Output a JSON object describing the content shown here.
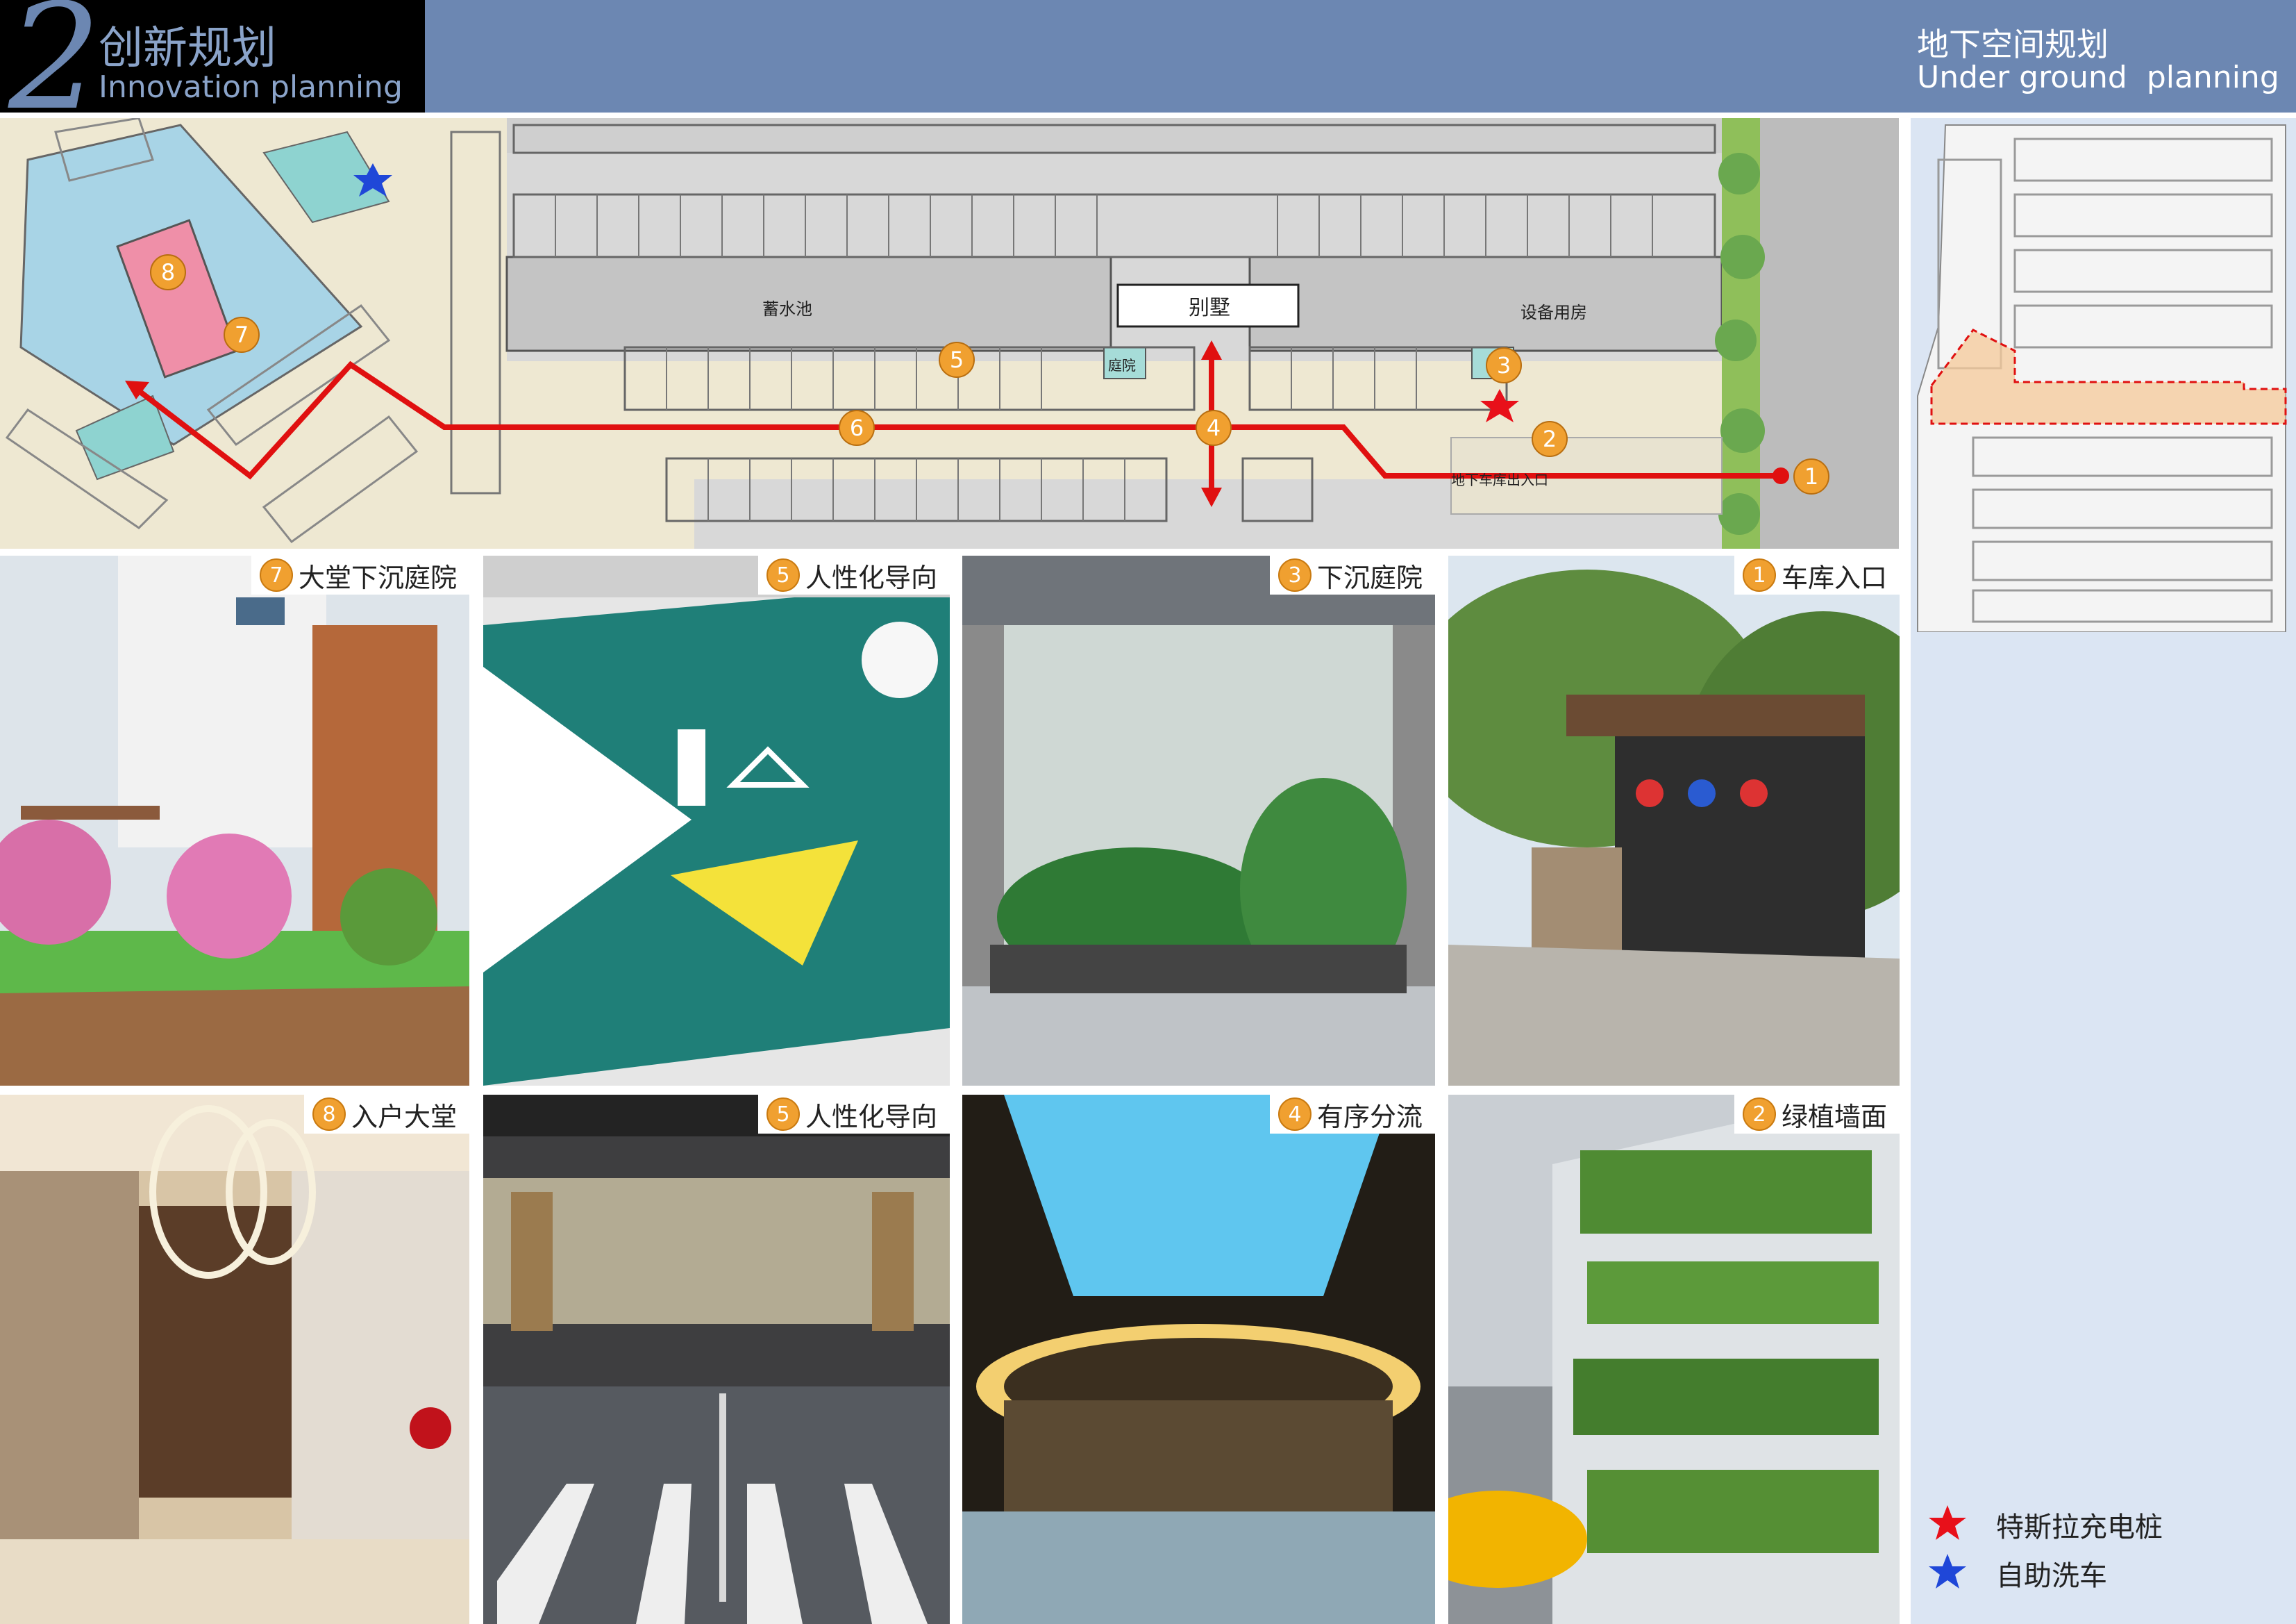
{
  "header": {
    "section_number": "2",
    "section_title_cn": "创新规划",
    "section_title_en": "Innovation planning",
    "page_title_cn": "地下空间规划",
    "page_title_en": "Under ground  planning"
  },
  "plan": {
    "labels": {
      "reservoir": "蓄水池",
      "villa": "别墅",
      "equipment_room": "设备用房",
      "courtyard": "庭院",
      "garage_entrance": "地下车库出入口"
    },
    "markers": [
      "1",
      "2",
      "3",
      "4",
      "5",
      "6",
      "7",
      "8"
    ]
  },
  "tiles": [
    {
      "num": "7",
      "label": "大堂下沉庭院"
    },
    {
      "num": "5",
      "label": "人性化导向"
    },
    {
      "num": "3",
      "label": "下沉庭院"
    },
    {
      "num": "1",
      "label": "车库入口"
    },
    {
      "num": "8",
      "label": "入户大堂"
    },
    {
      "num": "5",
      "label": "人性化导向"
    },
    {
      "num": "4",
      "label": "有序分流"
    },
    {
      "num": "2",
      "label": "绿植墙面"
    }
  ],
  "legend": [
    {
      "label": "特斯拉充电桩",
      "icon": "red-star-icon",
      "color": "#e8101a"
    },
    {
      "label": "自助洗车",
      "icon": "blue-star-icon",
      "color": "#1f47d8"
    }
  ],
  "colors": {
    "header_band": "#6c87b2",
    "route": "#e01010",
    "badge": "#f0a030",
    "right_panel": "#dbe5f3"
  }
}
